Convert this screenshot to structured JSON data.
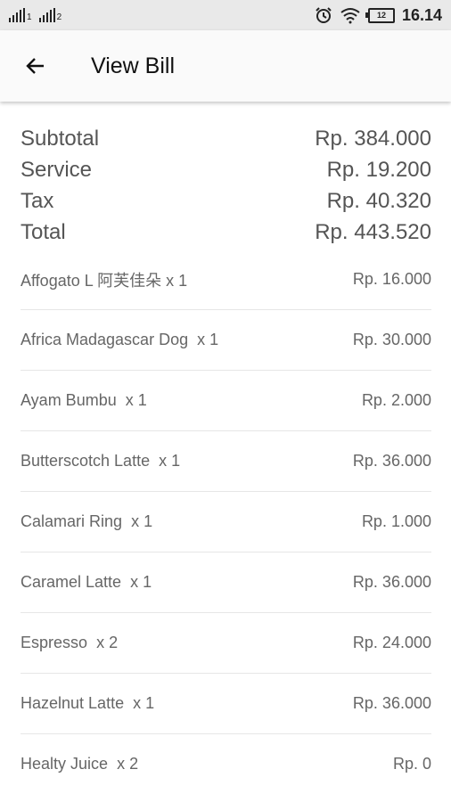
{
  "status_bar": {
    "sim1": "1",
    "sim2": "2",
    "battery": "12",
    "time": "16.14"
  },
  "header": {
    "title": "View Bill",
    "back_icon": "arrow-left-icon"
  },
  "summary": [
    {
      "label": "Subtotal",
      "value": "Rp. 384.000"
    },
    {
      "label": "Service",
      "value": "Rp. 19.200"
    },
    {
      "label": "Tax",
      "value": "Rp. 40.320"
    },
    {
      "label": "Total",
      "value": "Rp. 443.520"
    }
  ],
  "items": [
    {
      "name": "Affogato L 阿芙佳朵",
      "qty": "x 1",
      "price": "Rp. 16.000"
    },
    {
      "name": "Africa Madagascar Dog ",
      "qty": "x 1",
      "price": "Rp. 30.000"
    },
    {
      "name": "Ayam Bumbu ",
      "qty": "x 1",
      "price": "Rp. 2.000"
    },
    {
      "name": "Butterscotch Latte ",
      "qty": "x 1",
      "price": "Rp. 36.000"
    },
    {
      "name": "Calamari Ring ",
      "qty": "x 1",
      "price": "Rp. 1.000"
    },
    {
      "name": "Caramel Latte ",
      "qty": "x 1",
      "price": "Rp. 36.000"
    },
    {
      "name": "Espresso ",
      "qty": "x 2",
      "price": "Rp. 24.000"
    },
    {
      "name": "Hazelnut Latte ",
      "qty": "x 1",
      "price": "Rp. 36.000"
    },
    {
      "name": "Healty Juice ",
      "qty": "x 2",
      "price": "Rp. 0"
    }
  ]
}
